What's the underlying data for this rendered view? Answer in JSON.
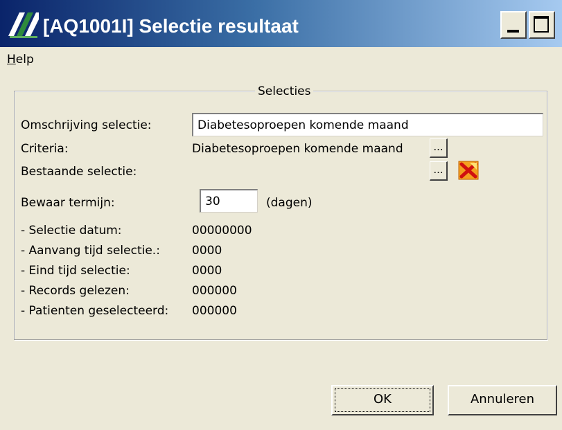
{
  "window": {
    "title": "[AQ1001I] Selectie resultaat",
    "icon": "app-logo-icon",
    "buttons": [
      "minimize-icon",
      "maximize-icon"
    ]
  },
  "menu": {
    "help_underlined": "H",
    "help_rest": "elp"
  },
  "group": {
    "legend": "Selecties"
  },
  "form": {
    "omschrijving_label": "Omschrijving selectie:",
    "omschrijving_value": "Diabetesoproepen komende maand",
    "criteria_label": "Criteria:",
    "criteria_value": "Diabetesoproepen komende maand",
    "bestaande_label": "Bestaande selectie:",
    "ellipsis": "...",
    "bewaar_label": "Bewaar termijn:",
    "bewaar_value": "30",
    "bewaar_unit": "(dagen)"
  },
  "info": [
    {
      "label": "- Selectie datum:",
      "value": "00000000"
    },
    {
      "label": "- Aanvang tijd selectie.:",
      "value": "0000"
    },
    {
      "label": "- Eind tijd selectie:",
      "value": "0000"
    },
    {
      "label": "- Records gelezen:",
      "value": "000000"
    },
    {
      "label": "- Patienten geselecteerd:",
      "value": "000000"
    }
  ],
  "buttons": {
    "ok": "OK",
    "cancel": "Annuleren"
  }
}
